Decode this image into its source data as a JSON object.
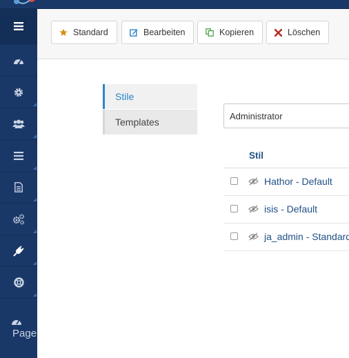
{
  "toolbar": {
    "buttons": [
      {
        "label": "Standard",
        "icon": "star-icon",
        "color": "#d4900f"
      },
      {
        "label": "Bearbeiten",
        "icon": "edit-icon",
        "color": "#2a86c7"
      },
      {
        "label": "Kopieren",
        "icon": "copy-icon",
        "color": "#3c9a3c"
      },
      {
        "label": "Löschen",
        "icon": "delete-icon",
        "color": "#b3261e"
      }
    ]
  },
  "sidebar": {
    "items": [
      {
        "icon": "menu-toggle-icon"
      },
      {
        "icon": "dashboard-icon"
      },
      {
        "icon": "gear-icon"
      },
      {
        "icon": "users-icon"
      },
      {
        "icon": "menus-icon"
      },
      {
        "icon": "article-icon"
      },
      {
        "icon": "components-icon"
      },
      {
        "icon": "plug-icon"
      },
      {
        "icon": "help-icon"
      }
    ],
    "page_builder_label": "Page Builder"
  },
  "tabs": {
    "stile": "Stile",
    "templates": "Templates"
  },
  "filter": {
    "client_value": "Administrator"
  },
  "table": {
    "column_header": "Stil",
    "rows": [
      {
        "name": "Hathor - Default"
      },
      {
        "name": "isis - Default"
      },
      {
        "name": "ja_admin - Standard"
      }
    ]
  },
  "colors": {
    "sidebar": "#1a3867",
    "accent": "#2a86c7",
    "link": "#1f4f86"
  }
}
